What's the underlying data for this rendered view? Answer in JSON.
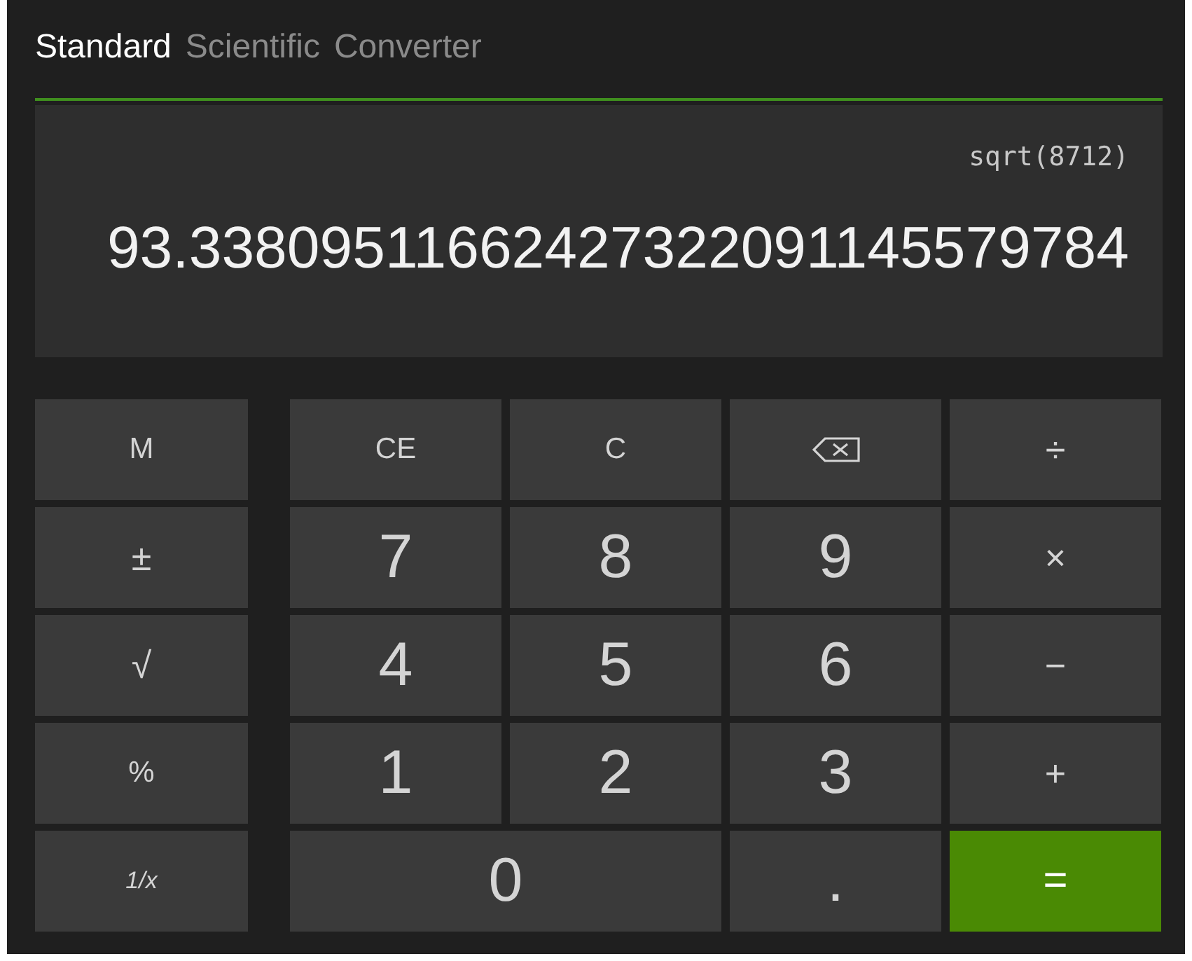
{
  "tabs": [
    {
      "label": "Standard",
      "selected": true
    },
    {
      "label": "Scientific",
      "selected": false
    },
    {
      "label": "Converter",
      "selected": false
    }
  ],
  "display": {
    "expression": "sqrt(8712)",
    "value": "93.33809511662427322091145579784"
  },
  "side_keys": [
    {
      "label": "M",
      "kind": "function"
    },
    {
      "label": "±",
      "kind": "operator"
    },
    {
      "label": "√",
      "kind": "operator"
    },
    {
      "label": "%",
      "kind": "function"
    },
    {
      "label": "1/x",
      "kind": "reciprocal"
    }
  ],
  "keys": [
    {
      "label": "CE",
      "kind": "function"
    },
    {
      "label": "C",
      "kind": "function"
    },
    {
      "kind": "backspace"
    },
    {
      "label": "÷",
      "kind": "operator"
    },
    {
      "label": "7",
      "kind": "digit"
    },
    {
      "label": "8",
      "kind": "digit"
    },
    {
      "label": "9",
      "kind": "digit"
    },
    {
      "label": "×",
      "kind": "operator"
    },
    {
      "label": "4",
      "kind": "digit"
    },
    {
      "label": "5",
      "kind": "digit"
    },
    {
      "label": "6",
      "kind": "digit"
    },
    {
      "label": "−",
      "kind": "operator"
    },
    {
      "label": "1",
      "kind": "digit"
    },
    {
      "label": "2",
      "kind": "digit"
    },
    {
      "label": "3",
      "kind": "digit"
    },
    {
      "label": "+",
      "kind": "operator"
    },
    {
      "label": "0",
      "kind": "wide-digit"
    },
    {
      "label": ".",
      "kind": "digit"
    },
    {
      "label": "=",
      "kind": "equals"
    }
  ]
}
